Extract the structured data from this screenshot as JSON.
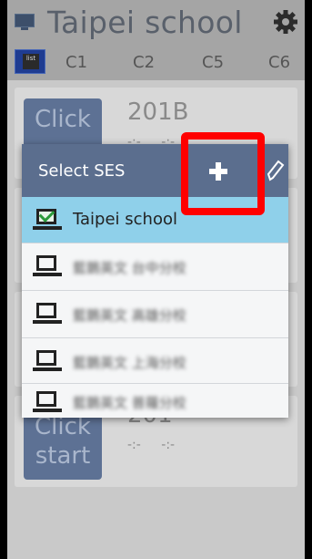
{
  "app_bar": {
    "title": "Taipei school"
  },
  "tabs": {
    "list_icon_text": "list",
    "items": [
      "C1",
      "C2",
      "C5",
      "C6"
    ]
  },
  "cards": [
    {
      "button": "Click",
      "room": "201B",
      "times": "-:- -:-"
    },
    {
      "button": "Click start",
      "room": "201",
      "times": "-:- -:-"
    }
  ],
  "dialog": {
    "title": "Select SES",
    "items": [
      {
        "name": "Taipei school",
        "selected": true
      },
      {
        "name": "藍鵲英文 台中分校",
        "selected": false
      },
      {
        "name": "藍鵲英文 高雄分校",
        "selected": false
      },
      {
        "name": "藍鵲英文 上海分校",
        "selected": false
      },
      {
        "name": "藍鵲英文 普羅分校",
        "selected": false
      }
    ]
  },
  "colors": {
    "highlight": "#ff0000",
    "selected_row": "#8fd0ea",
    "dialog_header": "#5b6e8e"
  }
}
